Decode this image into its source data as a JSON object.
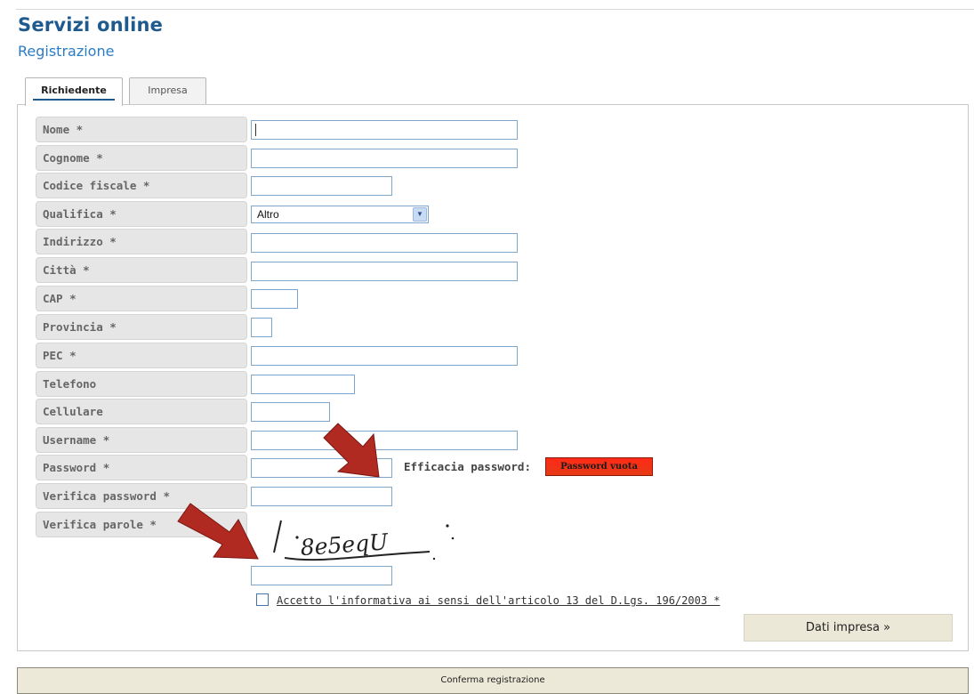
{
  "header": {
    "title": "Servizi online",
    "subtitle": "Registrazione"
  },
  "tabs": [
    {
      "label": "Richiedente",
      "active": true
    },
    {
      "label": "Impresa",
      "active": false
    }
  ],
  "form": {
    "fields": [
      {
        "label": "Nome *",
        "value": ""
      },
      {
        "label": "Cognome *",
        "value": ""
      },
      {
        "label": "Codice fiscale *",
        "value": ""
      },
      {
        "label": "Qualifica *",
        "value": "Altro"
      },
      {
        "label": "Indirizzo *",
        "value": ""
      },
      {
        "label": "Città *",
        "value": ""
      },
      {
        "label": "CAP *",
        "value": ""
      },
      {
        "label": "Provincia *",
        "value": ""
      },
      {
        "label": "PEC *",
        "value": ""
      },
      {
        "label": "Telefono",
        "value": ""
      },
      {
        "label": "Cellulare",
        "value": ""
      },
      {
        "label": "Username *",
        "value": ""
      },
      {
        "label": "Password *",
        "value": ""
      },
      {
        "label": "Verifica password *",
        "value": ""
      },
      {
        "label": "Verifica parole *",
        "value": ""
      }
    ],
    "password_strength": {
      "label": "Efficacia password:",
      "value": "Password vuota",
      "color": "#ff2a18"
    },
    "captcha_text": "8e5eqU",
    "consent_text": "Accetto l'informativa ai sensi dell'articolo 13 del D.Lgs. 196/2003 *",
    "consent_checked": false
  },
  "buttons": {
    "next": "Dati impresa »",
    "confirm": "Conferma registrazione"
  },
  "annotations": {
    "arrow_color": "#b02a22"
  }
}
